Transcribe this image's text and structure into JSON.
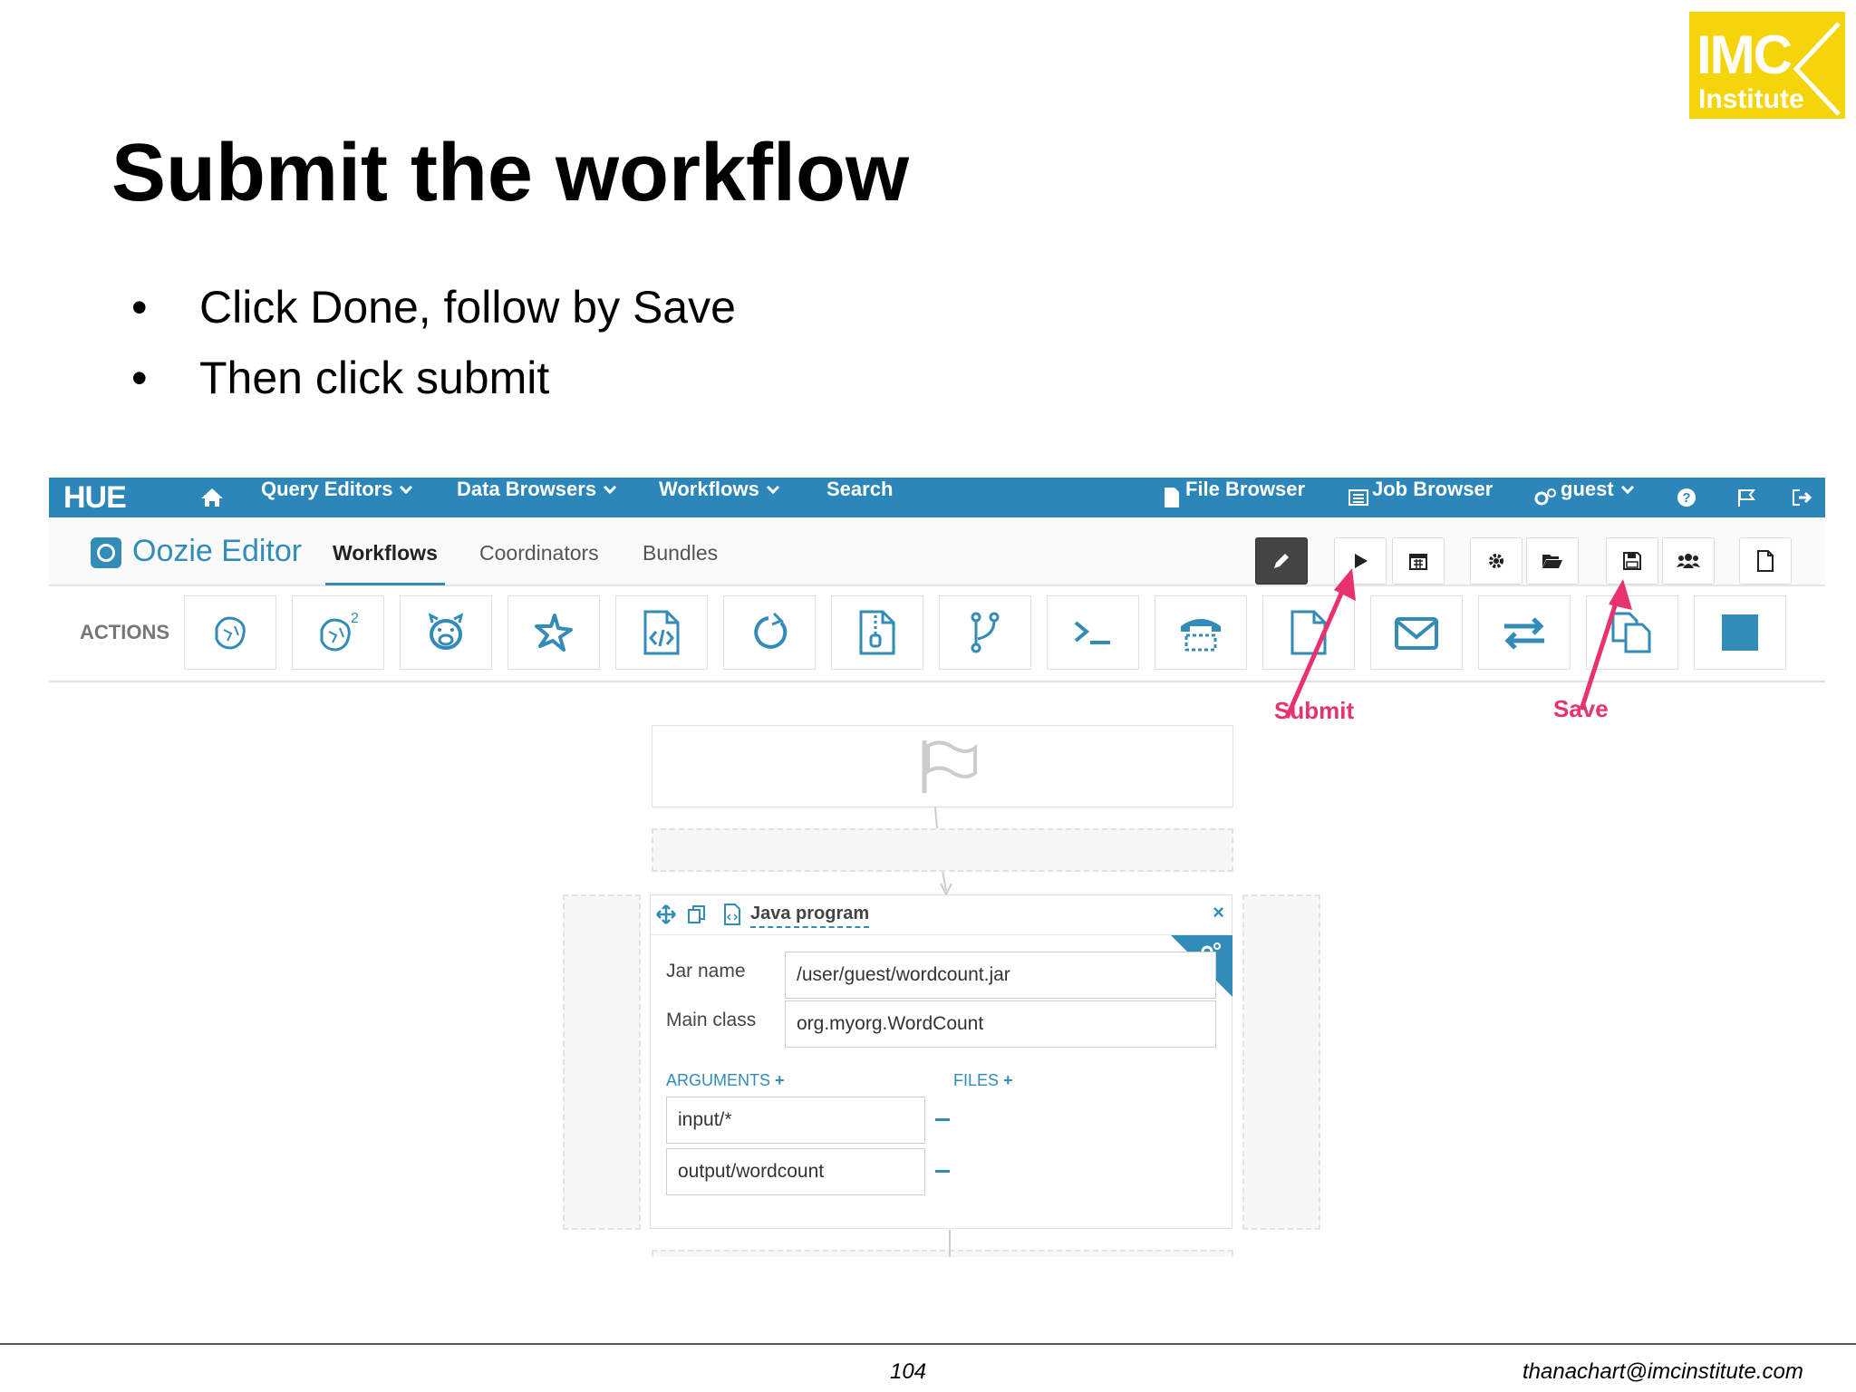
{
  "slide": {
    "title": "Submit the workflow",
    "bullets": [
      "Click Done, follow by Save",
      "Then click submit"
    ],
    "page_number": "104",
    "footer_email": "thanachart@imcinstitute.com",
    "logo": {
      "line1": "IMC",
      "line2": "Institute"
    }
  },
  "hue": {
    "logo": "HUE",
    "nav": {
      "query_editors": "Query Editors",
      "data_browsers": "Data Browsers",
      "workflows": "Workflows",
      "search": "Search",
      "file_browser": "File Browser",
      "job_browser": "Job Browser",
      "user": "guest"
    },
    "app_title": "Oozie Editor",
    "tabs": {
      "workflows": "Workflows",
      "coordinators": "Coordinators",
      "bundles": "Bundles"
    },
    "actions_label": "ACTIONS",
    "annotations": {
      "submit": "Submit",
      "save": "Save"
    },
    "java_node": {
      "title": "Java program",
      "jar_label": "Jar name",
      "jar_value": "/user/guest/wordcount.jar",
      "main_label": "Main class",
      "main_value": "org.myorg.WordCount",
      "arguments_label": "ARGUMENTS",
      "files_label": "FILES",
      "args": [
        "input/*",
        "output/wordcount"
      ]
    }
  },
  "colors": {
    "nav_blue": "#2d86b9",
    "accent_blue": "#338bb8",
    "annotation_pink": "#e8316f",
    "logo_yellow": "#f6d40a"
  }
}
